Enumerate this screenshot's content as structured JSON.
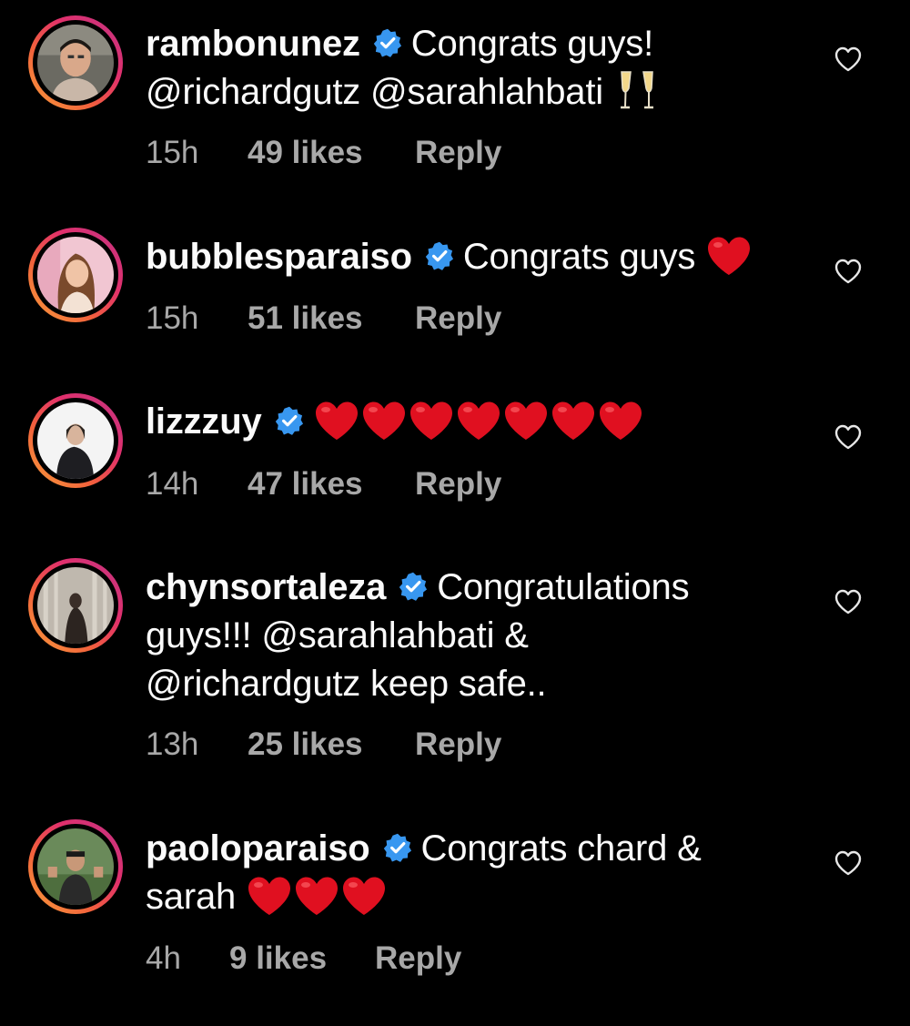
{
  "comments": [
    {
      "username": "rambonunez",
      "text": "Congrats guys! @richardgutz @sarahlahbati",
      "text_parts": [
        "Congrats guys!",
        "@richardgutz @sarahlahbati"
      ],
      "emoji": "clinking-glasses",
      "time": "15h",
      "likes": "49 likes",
      "reply": "Reply"
    },
    {
      "username": "bubblesparaiso",
      "text": "Congrats guys",
      "emoji": "red-heart",
      "time": "15h",
      "likes": "51 likes",
      "reply": "Reply"
    },
    {
      "username": "lizzzuy",
      "text": "",
      "emoji_count": 7,
      "emoji": "red-heart",
      "time": "14h",
      "likes": "47 likes",
      "reply": "Reply"
    },
    {
      "username": "chynsortaleza",
      "text": "Congratulations guys!!! @sarahlahbati & @richardgutz keep safe..",
      "text_parts": [
        "Congratulations",
        "guys!!! @sarahlahbati &",
        "@richardgutz keep safe.."
      ],
      "time": "13h",
      "likes": "25 likes",
      "reply": "Reply"
    },
    {
      "username": "paoloparaiso",
      "text": "Congrats chard & sarah",
      "text_parts": [
        "Congrats chard &",
        "sarah"
      ],
      "emoji_count": 3,
      "emoji": "red-heart",
      "time": "4h",
      "likes": "9 likes",
      "reply": "Reply"
    }
  ],
  "colors": {
    "background": "#000000",
    "text": "#fafafa",
    "meta": "#a8a8a8",
    "verified": "#3897f0",
    "heart": "#e01020"
  }
}
